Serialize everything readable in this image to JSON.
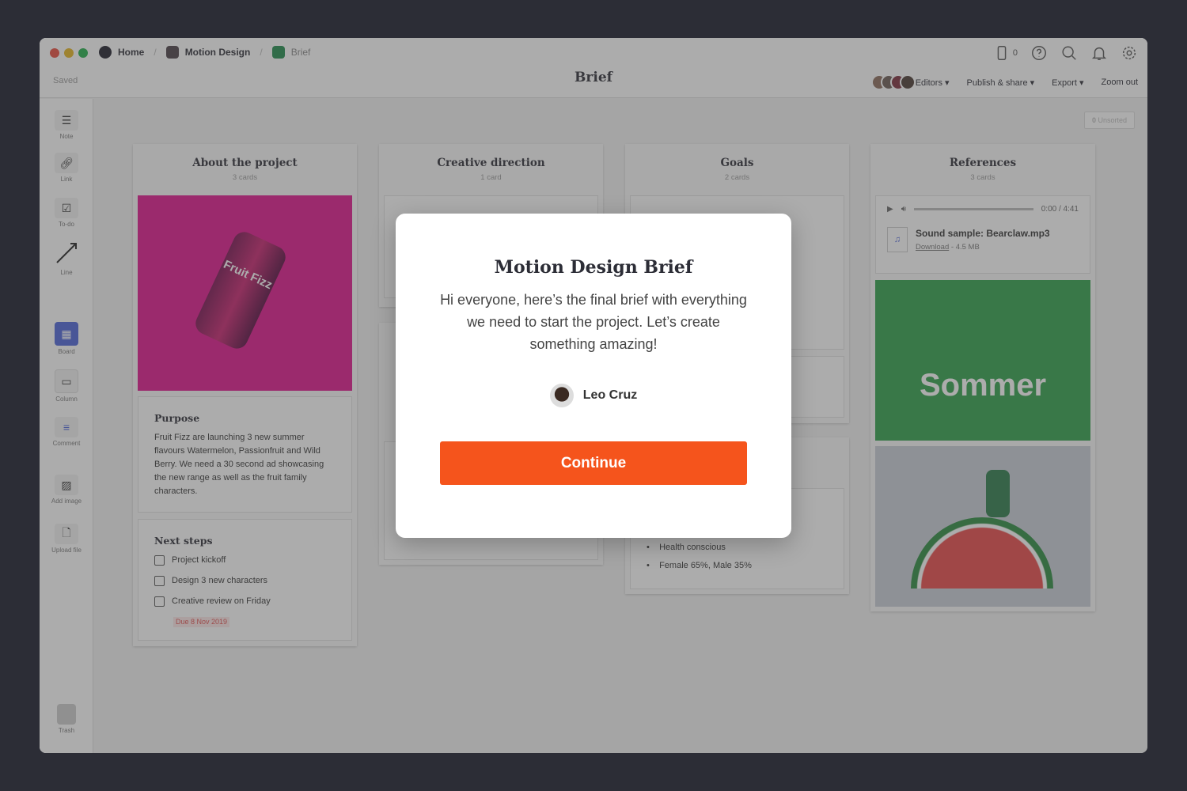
{
  "breadcrumb": [
    {
      "label": "Home",
      "color": "#1e1e2a"
    },
    {
      "label": "Motion Design",
      "color": "#4a3f46"
    },
    {
      "label": "Brief",
      "color": "#1f8a4c"
    }
  ],
  "status": "Saved",
  "title": "Brief",
  "header": {
    "device_count": "0",
    "editors": "Editors",
    "publish": "Publish & share",
    "export": "Export",
    "zoom_out": "Zoom out"
  },
  "sidebar": [
    {
      "label": "Note",
      "icon": "note-icon"
    },
    {
      "label": "Link",
      "icon": "link-icon"
    },
    {
      "label": "To-do",
      "icon": "todo-icon"
    },
    {
      "label": "Line",
      "icon": "line-icon"
    },
    {
      "label": "Board",
      "icon": "board-icon"
    },
    {
      "label": "Column",
      "icon": "column-icon"
    },
    {
      "label": "Comment",
      "icon": "comment-icon"
    },
    {
      "label": "Add image",
      "icon": "image-icon"
    },
    {
      "label": "Upload file",
      "icon": "file-icon"
    },
    {
      "label": "Trash",
      "icon": "trash-icon"
    }
  ],
  "unsorted": {
    "count": "0",
    "label": "Unsorted"
  },
  "columns": [
    {
      "title": "About the project",
      "count": "3 cards",
      "purpose": {
        "title": "Purpose",
        "text": "Fruit Fizz are launching 3 new summer flavours Watermelon, Passionfruit and Wild Berry. We need a 30 second ad showcasing the new range as well as the fruit family characters."
      },
      "next_steps": {
        "title": "Next steps",
        "items": [
          "Project kickoff",
          "Design 3 new characters",
          "Creative review on Friday"
        ],
        "due": "Due 8 Nov 2019"
      },
      "image_text": "Fruit Fizz"
    },
    {
      "title": "Creative direction",
      "count": "1 card"
    },
    {
      "title": "Goals",
      "count": "2 cards",
      "bullets": [
        "Health conscious",
        "Female 65%, Male 35%"
      ]
    },
    {
      "title": "References",
      "count": "3 cards",
      "audio": {
        "time": "0:00 / 4:41",
        "name": "Sound sample: Bearclaw.mp3",
        "download": "Download",
        "size": "- 4.5 MB"
      },
      "image_text": "Sommer"
    }
  ],
  "modal": {
    "title": "Motion Design Brief",
    "text": "Hi everyone, here’s the final brief with everything we need to start the project. Let’s create something amazing!",
    "author": "Leo Cruz",
    "button": "Continue",
    "button_color": "#f5541c"
  }
}
